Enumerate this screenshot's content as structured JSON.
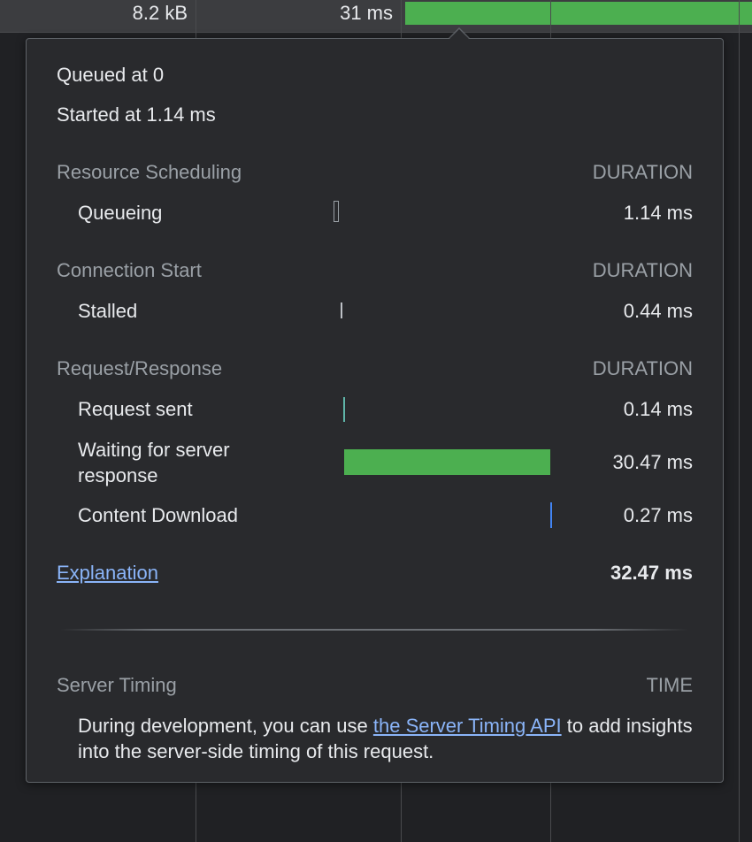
{
  "network_row": {
    "size": "8.2 kB",
    "time": "31 ms"
  },
  "timing": {
    "queued_at": "Queued at 0",
    "started_at": "Started at 1.14 ms",
    "duration_header": "DURATION",
    "sections": [
      {
        "title": "Resource Scheduling",
        "rows": [
          {
            "label": "Queueing",
            "value": "1.14 ms"
          }
        ]
      },
      {
        "title": "Connection Start",
        "rows": [
          {
            "label": "Stalled",
            "value": "0.44 ms"
          }
        ]
      },
      {
        "title": "Request/Response",
        "rows": [
          {
            "label": "Request sent",
            "value": "0.14 ms"
          },
          {
            "label": "Waiting for server response",
            "value": "30.47 ms"
          },
          {
            "label": "Content Download",
            "value": "0.27 ms"
          }
        ]
      }
    ],
    "explanation_link": "Explanation",
    "total": "32.47 ms"
  },
  "server_timing": {
    "title": "Server Timing",
    "time_header": "TIME",
    "desc_prefix": "During development, you can use ",
    "desc_link": "the Server Timing API",
    "desc_suffix": " to add insights into the server-side timing of this request."
  },
  "colors": {
    "waiting_bar": "#4caf50",
    "download_bar": "#4285f4",
    "link": "#8ab4f8"
  }
}
